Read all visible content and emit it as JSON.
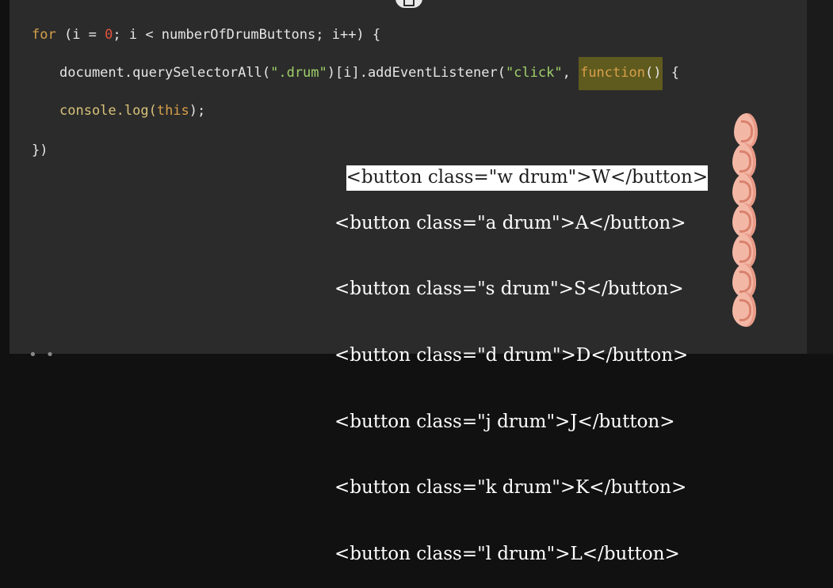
{
  "code": {
    "line1": {
      "kw_for": "for",
      "open": " (i = ",
      "zero": "0",
      "rest": "; i < numberOfDrumButtons; i++) {"
    },
    "line2": {
      "prefix": "document.querySelectorAll(",
      "str_drum": "\".drum\"",
      "mid": ")[i].addEventListener(",
      "str_click": "\"click\"",
      "comma": ", ",
      "kw_function": "function",
      "paren": "()",
      "brace": " {"
    },
    "line3": {
      "prefix": "console.log(",
      "kw_this": "this",
      "suffix": ");"
    },
    "line4": "})"
  },
  "popup": {
    "rows": [
      "<button class=\"w drum\">W</button>",
      "<button class=\"a drum\">A</button>",
      "<button class=\"s drum\">S</button>",
      "<button class=\"d drum\">D</button>",
      "<button class=\"j drum\">J</button>",
      "<button class=\"k drum\">K</button>",
      "<button class=\"l drum\">L</button>"
    ]
  },
  "icons": {
    "top": "window-icon",
    "ear": "ear-icon"
  },
  "bottom": {
    "dots": "• •"
  }
}
